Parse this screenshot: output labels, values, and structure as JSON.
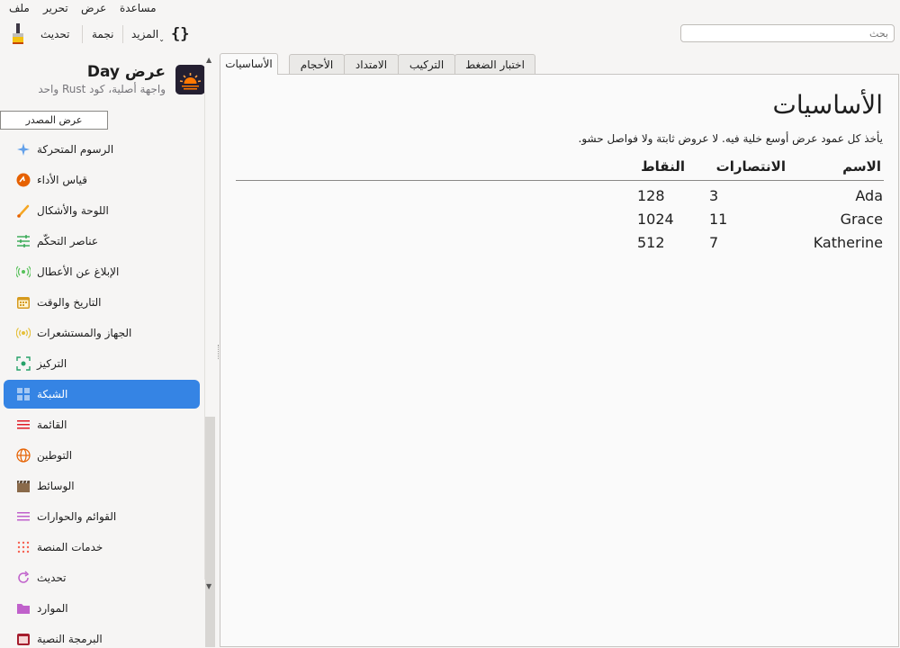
{
  "menu": [
    "ملف",
    "تحرير",
    "عرض",
    "مساعدة"
  ],
  "toolbar": {
    "refresh": "تحديث",
    "star": "نجمة",
    "more": "المزيد",
    "inspector_glyph": "{}"
  },
  "search": {
    "placeholder": "بحث"
  },
  "app": {
    "title": "عرض Day",
    "subtitle": "واجهة أصلية، كود Rust واحد",
    "source_button": "عرض المصدر"
  },
  "nav": [
    {
      "label": "الرسوم المتحركة",
      "icon": "sparkles-icon",
      "color": "#62a0ea"
    },
    {
      "label": "قياس الأداء",
      "icon": "speedometer-icon",
      "color": "#e66100"
    },
    {
      "label": "اللوحة والأشكال",
      "icon": "brush-icon",
      "color": "#f5a623"
    },
    {
      "label": "عناصر التحكّم",
      "icon": "sliders-icon",
      "color": "#33a852"
    },
    {
      "label": "الإبلاغ عن الأعطال",
      "icon": "broadcast-icon",
      "color": "#57c05a"
    },
    {
      "label": "التاريخ والوقت",
      "icon": "calendar-icon",
      "color": "#d69a1e"
    },
    {
      "label": "الجهاز والمستشعرات",
      "icon": "sensor-icon",
      "color": "#e5c03a"
    },
    {
      "label": "التركيز",
      "icon": "focus-icon",
      "color": "#26a269"
    },
    {
      "label": "الشبكة",
      "icon": "grid-icon",
      "color": "#ffffff"
    },
    {
      "label": "القائمة",
      "icon": "list-icon",
      "color": "#e01b24"
    },
    {
      "label": "التوطين",
      "icon": "globe-icon",
      "color": "#e66100"
    },
    {
      "label": "الوسائط",
      "icon": "clapper-icon",
      "color": "#8a6a4a"
    },
    {
      "label": "القوائم والحوارات",
      "icon": "menu-icon",
      "color": "#c061cb"
    },
    {
      "label": "خدمات المنصة",
      "icon": "dots-grid-icon",
      "color": "#f66151"
    },
    {
      "label": "تحديث",
      "icon": "refresh-icon",
      "color": "#c061cb"
    },
    {
      "label": "الموارد",
      "icon": "folder-icon",
      "color": "#c061cb"
    },
    {
      "label": "البرمجة النصية",
      "icon": "script-icon",
      "color": "#a51d2d"
    }
  ],
  "tabs": [
    "الأساسيات",
    "الأحجام",
    "الامتداد",
    "التركيب",
    "اختبار الضغط"
  ],
  "main": {
    "title": "الأساسيات",
    "description": "يأخذ كل عمود عرض أوسع خلية فيه. لا عروض ثابتة ولا فواصل حشو.",
    "columns": [
      "الاسم",
      "الانتصارات",
      "النقاط"
    ],
    "rows": [
      [
        "Ada",
        "3",
        "128"
      ],
      [
        "Grace",
        "11",
        "1024"
      ],
      [
        "Katherine",
        "7",
        "512"
      ]
    ]
  },
  "colors": {
    "accent": "#3584e4"
  }
}
